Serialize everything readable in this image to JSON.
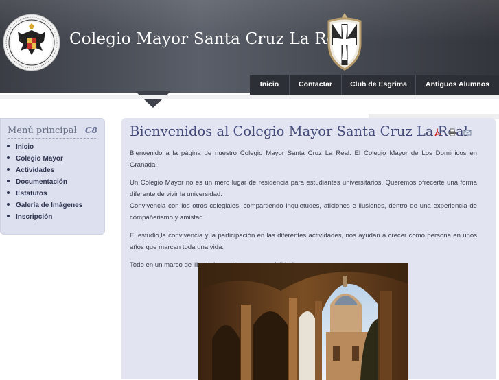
{
  "header": {
    "site_title": "Colegio Mayor Santa Cruz La Real",
    "seal_icon": "university-seal-icon",
    "crest_icon": "dominican-crest-icon"
  },
  "nav": {
    "items": [
      "Inicio",
      "Contactar",
      "Club de Esgrima",
      "Antiguos Alumnos"
    ]
  },
  "sidebar": {
    "title": "Menú principal",
    "logo_text": "C8",
    "items": [
      "Inicio",
      "Colegio Mayor",
      "Actividades",
      "Documentación",
      "Estatutos",
      "Galería de Imágenes",
      "Inscripción"
    ]
  },
  "main": {
    "title": "Bienvenidos al Colegio Mayor Santa Cruz La Real",
    "tools": [
      "pdf-icon",
      "print-icon",
      "email-icon"
    ],
    "paragraphs": [
      "Bienvenido a la página de nuestro Colegio Mayor Santa Cruz La Real. El Colegio Mayor de Los Dominicos en Granada.",
      "Un Colegio Mayor no es un mero lugar de residencia para estudiantes universitarios. Queremos ofrecerte una forma diferente de vivir la universidad.",
      "Convivencia con los otros colegiales, compartiendo inquietudes, aficiones e ilusiones, dentro de una experiencia de compañerismo y amistad.",
      "El estudio,la convivencia y la participación en las diferentes actividades, nos ayudan a crecer como persona en unos años que marcan toda una vida.",
      "Todo en un marco de libertad, respeto y responsabilidad."
    ]
  },
  "colors": {
    "header_dark": "#3a3d44",
    "nav_bg": "#2c2f35",
    "panel_bg": "#e2e4f2",
    "title_color": "#444b7a"
  }
}
